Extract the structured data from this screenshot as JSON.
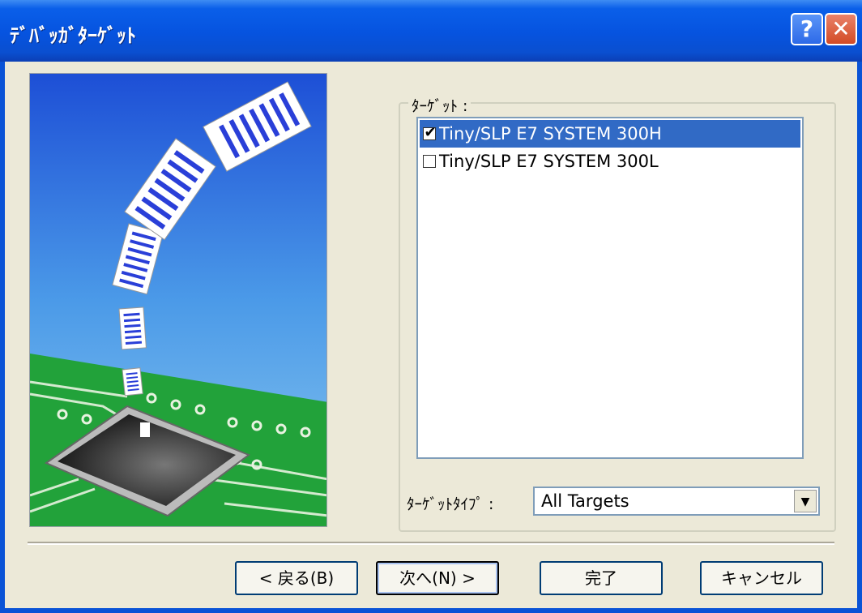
{
  "window": {
    "title": "ﾃﾞﾊﾞｯｶﾞﾀｰｹﾞｯﾄ",
    "help_label": "?",
    "close_label": "✕"
  },
  "group": {
    "label": "ﾀｰｹﾞｯﾄ :"
  },
  "targets": [
    {
      "label": "Tiny/SLP E7 SYSTEM 300H",
      "checked": true,
      "selected": true
    },
    {
      "label": "Tiny/SLP E7 SYSTEM 300L",
      "checked": false,
      "selected": false
    }
  ],
  "target_type": {
    "label": "ﾀｰｹﾞｯﾄﾀｲﾌﾟ :",
    "value": "All Targets",
    "arrow": "▼"
  },
  "buttons": {
    "back": "< 戻る(B)",
    "next": "次へ(N) >",
    "finish": "完了",
    "cancel": "キャンセル"
  },
  "check_glyph": "✔"
}
